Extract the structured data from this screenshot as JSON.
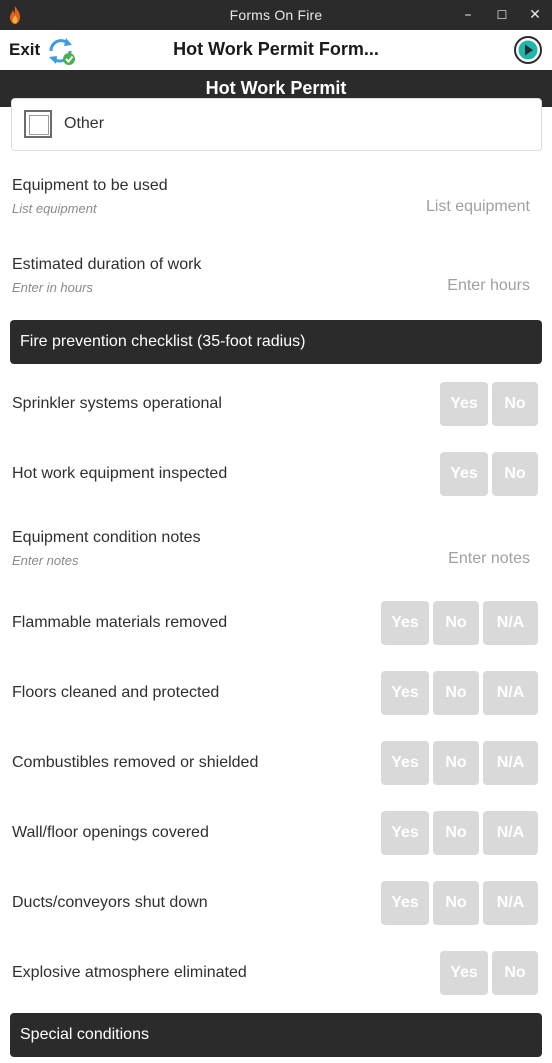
{
  "window": {
    "title": "Forms On Fire",
    "minimize": "–",
    "maximize": "☐",
    "close": "✕"
  },
  "header": {
    "exit_label": "Exit",
    "form_title": "Hot Work Permit Form..."
  },
  "page": {
    "title": "Hot Work Permit"
  },
  "other_option": {
    "label": "Other"
  },
  "fields": {
    "equipment": {
      "label": "Equipment to be used",
      "hint": "List equipment",
      "placeholder": "List equipment"
    },
    "duration": {
      "label": "Estimated duration of work",
      "hint": "Enter in hours",
      "placeholder": "Enter hours"
    },
    "notes": {
      "label": "Equipment condition notes",
      "hint": "Enter notes",
      "placeholder": "Enter notes"
    }
  },
  "sections": {
    "fire_prevention": "Fire prevention checklist (35-foot radius)",
    "special_conditions": "Special conditions"
  },
  "options": {
    "yes": "Yes",
    "no": "No",
    "na": "N/A"
  },
  "questions": {
    "sprinkler": "Sprinkler systems operational",
    "hot_work_equipment": "Hot work equipment inspected",
    "flammable": "Flammable materials removed",
    "floors": "Floors cleaned and protected",
    "combustibles": "Combustibles removed or shielded",
    "openings": "Wall/floor openings covered",
    "ducts": "Ducts/conveyors shut down",
    "explosive": "Explosive atmosphere eliminated"
  },
  "colors": {
    "titlebar": "#2b2b2b",
    "section": "#2b2b2b",
    "button_inactive": "#d9d9d9",
    "sync_blue": "#3d9be0",
    "sync_green": "#4caf50",
    "next_teal": "#1fb5a8"
  }
}
